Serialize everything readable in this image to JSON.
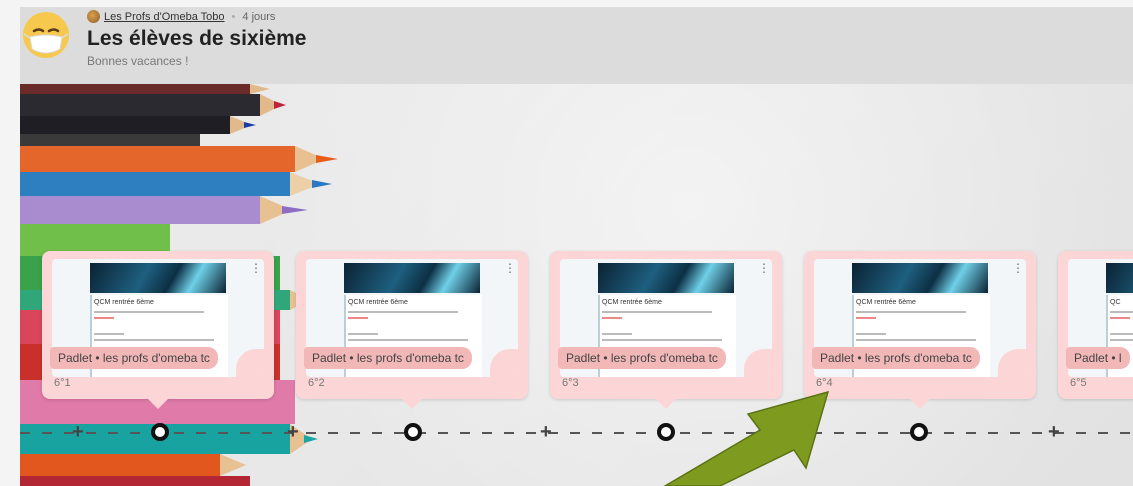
{
  "header": {
    "author": "Les Profs d'Omeba Tobo",
    "separator": "•",
    "time_ago": "4 jours",
    "title": "Les élèves de sixième",
    "subtitle": "Bonnes vacances !"
  },
  "cards": [
    {
      "source": "Padlet • les profs d'omeba tc",
      "caption": "6°1",
      "form_title": "QCM rentrée 6ème"
    },
    {
      "source": "Padlet • les profs d'omeba tc",
      "caption": "6°2",
      "form_title": "QCM rentrée 6ème"
    },
    {
      "source": "Padlet • les profs d'omeba tc",
      "caption": "6°3",
      "form_title": "QCM rentrée 6ème"
    },
    {
      "source": "Padlet • les profs d'omeba tc",
      "caption": "6°4",
      "form_title": "QCM rentrée 6ème"
    },
    {
      "source": "Padlet • l",
      "caption": "6°5",
      "form_title": "QC"
    }
  ],
  "colors": {
    "card": "#fcd6d6",
    "card_tag": "#f2b7b7",
    "arrow": "#7f9b1f",
    "header": "#dcdcdc"
  },
  "icons": {
    "card_menu": "more-vert-icon",
    "avatar": "masked-face-icon"
  }
}
